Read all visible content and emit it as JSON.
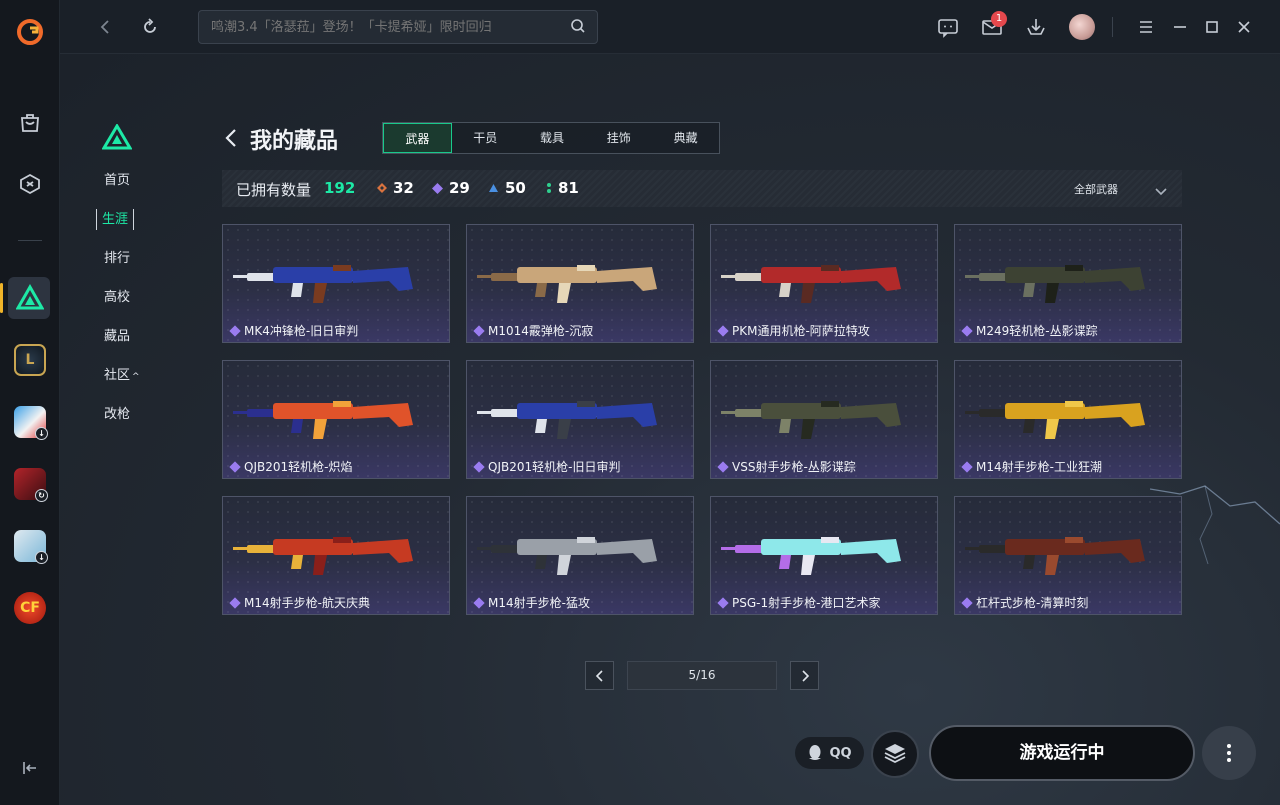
{
  "search": {
    "placeholder": "鸣潮3.4「洛瑟菈」登场！「卡提希娅」限时回归"
  },
  "notifications": {
    "mail_count": "1"
  },
  "subnav": {
    "items": [
      "首页",
      "生涯",
      "排行",
      "高校",
      "藏品",
      "社区",
      "改枪"
    ],
    "active_index": 1
  },
  "header": {
    "title": "我的藏品",
    "tabs": [
      "武器",
      "干员",
      "载具",
      "挂饰",
      "典藏"
    ],
    "active_tab": 0
  },
  "summary": {
    "owned_label": "已拥有数量",
    "owned_total": "192",
    "stats": [
      {
        "rarity": "orange",
        "color": "#d9733f",
        "count": "32"
      },
      {
        "rarity": "purple",
        "color": "#9a7cf0",
        "count": "29"
      },
      {
        "rarity": "blue",
        "color": "#4a90e2",
        "count": "50"
      },
      {
        "rarity": "green",
        "color": "#2fd08f",
        "count": "81"
      }
    ],
    "filter": "全部武器"
  },
  "items": [
    {
      "name": "MK4冲锋枪-旧日审判",
      "palette": [
        "#2a3fa8",
        "#dfe3ea",
        "#7a3b20"
      ]
    },
    {
      "name": "M1014霰弹枪-沉寂",
      "palette": [
        "#c9a67a",
        "#8a6a48",
        "#e6d7b8"
      ]
    },
    {
      "name": "PKM通用机枪-阿萨拉特攻",
      "palette": [
        "#b22a2a",
        "#d7d2c8",
        "#5a2a22"
      ]
    },
    {
      "name": "M249轻机枪-丛影谍踪",
      "palette": [
        "#3d4233",
        "#6b7060",
        "#1e2119"
      ]
    },
    {
      "name": "QJB201轻机枪-炽焰",
      "palette": [
        "#e0532a",
        "#2b2f8f",
        "#f2a23a"
      ]
    },
    {
      "name": "QJB201轻机枪-旧日审判",
      "palette": [
        "#2a3fa8",
        "#dfe3ea",
        "#3a3f48"
      ]
    },
    {
      "name": "VSS射手步枪-丛影谍踪",
      "palette": [
        "#4a4f3c",
        "#7d8268",
        "#262a20"
      ]
    },
    {
      "name": "M14射手步枪-工业狂潮",
      "palette": [
        "#d9a21f",
        "#2a2a2a",
        "#f0c84a"
      ]
    },
    {
      "name": "M14射手步枪-航天庆典",
      "palette": [
        "#c63a22",
        "#e8b23a",
        "#8a1f1a"
      ]
    },
    {
      "name": "M14射手步枪-猛攻",
      "palette": [
        "#9aa0a8",
        "#2e3238",
        "#d0d4da"
      ]
    },
    {
      "name": "PSG-1射手步枪-港口艺术家",
      "palette": [
        "#8ee8ea",
        "#b46de8",
        "#e8e8f2"
      ]
    },
    {
      "name": "杠杆式步枪-清算时刻",
      "palette": [
        "#6a2a1e",
        "#2a2a2a",
        "#9a4a2e"
      ]
    }
  ],
  "pager": {
    "display": "5/16"
  },
  "bottom": {
    "qq_label": "QQ",
    "run_label": "游戏运行中"
  },
  "colors": {
    "accent": "#1de9a6",
    "badge": "#e5484d",
    "rail_active": "#f0b429"
  }
}
